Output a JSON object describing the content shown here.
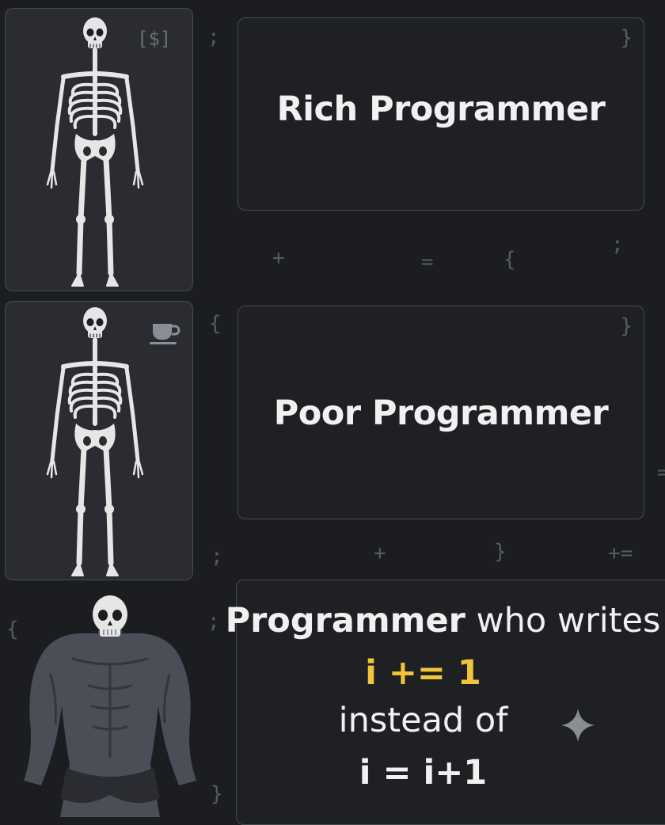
{
  "panels": [
    {
      "caption": "Rich Programmer",
      "badge": "[$]",
      "badge_icon": "dollar-bracket-icon"
    },
    {
      "caption": "Poor Programmer",
      "badge_icon": "coffee-cup-icon"
    }
  ],
  "third": {
    "line1_bold": "Programmer",
    "line1_rest": " who writes",
    "code_good": "i += 1",
    "mid_text": "instead of",
    "code_bad": "i = i+1",
    "sparkle_icon": "sparkle-icon"
  },
  "background_symbols": [
    ";",
    "}",
    "+",
    "=",
    "{",
    ";",
    "{",
    "}",
    ";",
    "+",
    "}",
    "+=",
    "=",
    "{",
    ";",
    "}"
  ],
  "colors": {
    "background": "#1b1d21",
    "accent_yellow": "#f2c43a",
    "bone": "#e4e4e4",
    "muscle": "#4a4e57"
  }
}
